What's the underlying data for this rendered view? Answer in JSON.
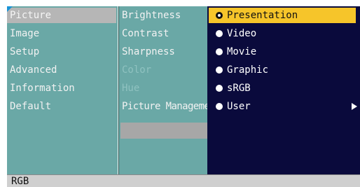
{
  "main_menu": {
    "items": [
      {
        "label": "Picture",
        "selected": true
      },
      {
        "label": "Image"
      },
      {
        "label": "Setup"
      },
      {
        "label": "Advanced"
      },
      {
        "label": "Information"
      },
      {
        "label": "Default"
      }
    ]
  },
  "submenu": {
    "items": [
      {
        "label": "Brightness"
      },
      {
        "label": "Contrast"
      },
      {
        "label": "Sharpness"
      },
      {
        "label": "Color",
        "disabled": true
      },
      {
        "label": "Hue",
        "disabled": true
      },
      {
        "label": "Picture Management"
      }
    ]
  },
  "options": {
    "items": [
      {
        "label": "Presentation",
        "selected": true
      },
      {
        "label": "Video"
      },
      {
        "label": "Movie"
      },
      {
        "label": "Graphic"
      },
      {
        "label": "sRGB"
      },
      {
        "label": "User",
        "has_submenu": true
      }
    ]
  },
  "status_bar": {
    "source": "RGB"
  },
  "colors": {
    "menu_bg": "#6aa8a6",
    "options_bg": "#0a0a3c",
    "selected_highlight": "#f6c52a",
    "main_selected": "#b6b6b6",
    "status_bg": "#cfcfcf",
    "corner_accent": "#1a93d6"
  },
  "icons": {
    "selected_option": "radio-selected-icon",
    "option": "bullet-icon",
    "submenu": "arrow-right-icon"
  }
}
